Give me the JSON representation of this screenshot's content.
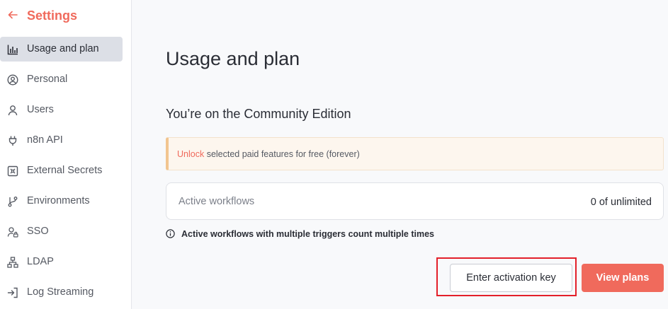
{
  "sidebar": {
    "title": "Settings",
    "back_icon": "arrow-left-icon",
    "items": [
      {
        "label": "Usage and plan",
        "icon": "bar-chart-icon",
        "active": true
      },
      {
        "label": "Personal",
        "icon": "user-circle-icon"
      },
      {
        "label": "Users",
        "icon": "user-icon"
      },
      {
        "label": "n8n API",
        "icon": "plug-icon"
      },
      {
        "label": "External Secrets",
        "icon": "vault-icon"
      },
      {
        "label": "Environments",
        "icon": "git-branch-icon"
      },
      {
        "label": "SSO",
        "icon": "user-lock-icon"
      },
      {
        "label": "LDAP",
        "icon": "network-icon"
      },
      {
        "label": "Log Streaming",
        "icon": "sign-in-icon"
      }
    ]
  },
  "main": {
    "title": "Usage and plan",
    "edition": "You’re on the Community Edition",
    "notice": {
      "link": "Unlock",
      "text": "selected paid features for free (forever)"
    },
    "usage": {
      "label": "Active workflows",
      "value": "0 of unlimited"
    },
    "info": "Active workflows with multiple triggers count multiple times",
    "buttons": {
      "activation": "Enter activation key",
      "plans": "View plans"
    }
  },
  "colors": {
    "accent": "#f06a5c",
    "highlight": "#e3202a",
    "active_bg": "#dcdfe6"
  }
}
